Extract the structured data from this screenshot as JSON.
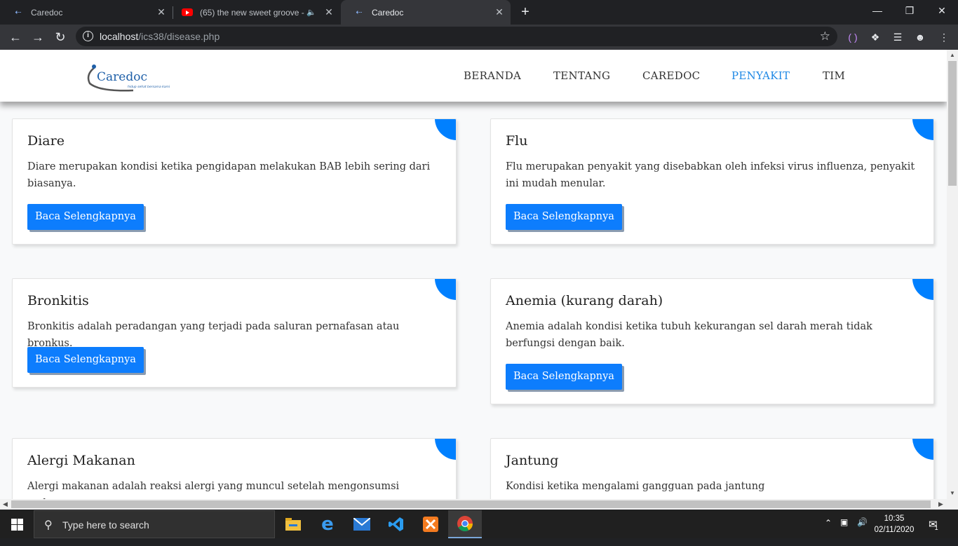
{
  "browser": {
    "tabs": [
      {
        "title": "Caredoc",
        "active": false
      },
      {
        "title": "(65) the new sweet groove -",
        "active": false,
        "audio": true
      },
      {
        "title": "Caredoc",
        "active": true
      }
    ],
    "url_host": "localhost",
    "url_path": "/ics38/disease.php"
  },
  "site": {
    "logo_text": "Caredoc",
    "logo_tagline": "hidup sehat bersama kami",
    "nav": [
      "BERANDA",
      "TENTANG",
      "CAREDOC",
      "PENYAKIT",
      "TIM"
    ],
    "active_nav": "PENYAKIT"
  },
  "diseases": [
    {
      "name": "Diare",
      "desc": "Diare merupakan kondisi ketika pengidapan melakukan BAB lebih sering dari biasanya.",
      "button": "Baca Selengkapnya"
    },
    {
      "name": "Flu",
      "desc": "Flu merupakan penyakit yang disebabkan oleh infeksi virus influenza, penyakit ini mudah menular.",
      "button": "Baca Selengkapnya"
    },
    {
      "name": "Bronkitis",
      "desc": "Bronkitis adalah peradangan yang terjadi pada saluran pernafasan atau bronkus.",
      "button": "Baca Selengkapnya"
    },
    {
      "name": "Anemia (kurang darah)",
      "desc": "Anemia adalah kondisi ketika tubuh kekurangan sel darah merah tidak berfungsi dengan baik.",
      "button": "Baca Selengkapnya"
    },
    {
      "name": "Alergi Makanan",
      "desc": "Alergi makanan adalah reaksi alergi yang muncul setelah mengonsumsi makanan",
      "button": ""
    },
    {
      "name": "Jantung",
      "desc": "Kondisi ketika mengalami gangguan pada jantung",
      "button": ""
    }
  ],
  "colors": {
    "accent": "#0d7dfd",
    "corner": "#0080ff",
    "nav_active": "#1e88e5"
  },
  "taskbar": {
    "search_placeholder": "Type here to search",
    "time": "10:35",
    "date": "02/11/2020",
    "notification_count": "1",
    "apps": [
      "file-explorer-icon",
      "edge-icon",
      "mail-icon",
      "vscode-icon",
      "xampp-icon",
      "chrome-icon"
    ]
  }
}
